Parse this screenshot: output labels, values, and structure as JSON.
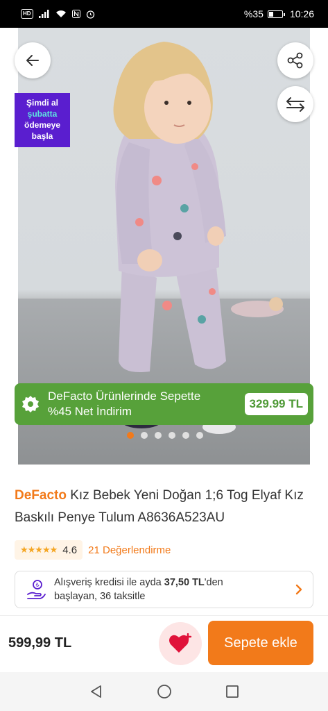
{
  "status_bar": {
    "network_badge": "HD",
    "battery_text": "%35",
    "battery_level": 0.35,
    "time": "10:26"
  },
  "gallery": {
    "back_icon": "arrow-left-icon",
    "share_icon": "share-icon",
    "compare_icon": "compare-arrows-icon",
    "promo_tag": {
      "line1": "Şimdi al",
      "line2": "şubatta",
      "line3": "ödemeye",
      "line4": "başla"
    },
    "discount_banner": {
      "icon": "badge-percent-icon",
      "line1": "DeFacto Ürünlerinde Sepette",
      "line2": "%45 Net İndirim",
      "price": "329.99 TL",
      "color": "#57a13a"
    },
    "dots_total": 6,
    "active_dot": 1
  },
  "product": {
    "brand": "DeFacto",
    "name": "Kız Bebek Yeni Doğan 1;6 Tog Elyaf Kız Baskılı Penye Tulum A8636A523AU",
    "stars": "★★★★★",
    "rating": "4.6",
    "reviews": "21 Değerlendirme"
  },
  "credit": {
    "icon": "hand-coin-icon",
    "prefix": "Alışveriş kredisi ile ayda ",
    "amount": "37,50 TL",
    "suffix": "'den",
    "line2": "başlayan, 36 taksitle"
  },
  "action_bar": {
    "price": "599,99 TL",
    "favorite_icon": "heart-icon",
    "add_to_cart": "Sepete ekle",
    "accent": "#f27a1a"
  },
  "nav_bar": {
    "back": "nav-back-icon",
    "home": "nav-home-icon",
    "recents": "nav-recents-icon"
  }
}
